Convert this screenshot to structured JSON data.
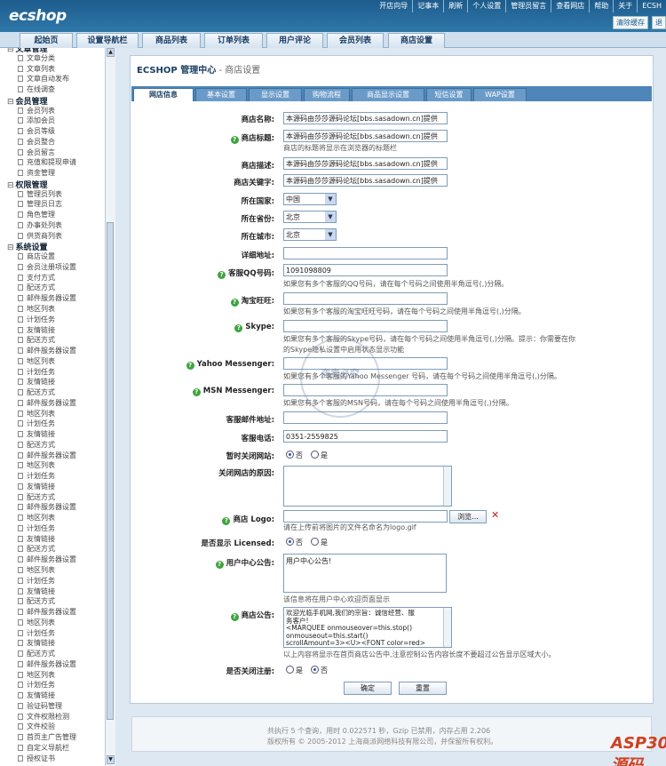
{
  "header": {
    "logo": "ecshop",
    "top_links": [
      "开店向导",
      "记事本",
      "刷新",
      "个人设置",
      "管理员留言",
      "查看网店",
      "帮助",
      "关于",
      "ECSH"
    ],
    "buttons": [
      "清除缓存",
      "退"
    ]
  },
  "main_nav": [
    "起始页",
    "设置导航栏",
    "商品列表",
    "订单列表",
    "用户评论",
    "会员列表",
    "商店设置"
  ],
  "sidebar": [
    {
      "t": "g",
      "label": "文章管理"
    },
    {
      "t": "i",
      "label": "文章分类"
    },
    {
      "t": "i",
      "label": "文章列表"
    },
    {
      "t": "i",
      "label": "文章自动发布"
    },
    {
      "t": "i",
      "label": "在线调查"
    },
    {
      "t": "g",
      "label": "会员管理"
    },
    {
      "t": "i",
      "label": "会员列表"
    },
    {
      "t": "i",
      "label": "添加会员"
    },
    {
      "t": "i",
      "label": "会员等级"
    },
    {
      "t": "i",
      "label": "会员整合"
    },
    {
      "t": "i",
      "label": "会员留言"
    },
    {
      "t": "i",
      "label": "充值和提现申请"
    },
    {
      "t": "i",
      "label": "资金管理"
    },
    {
      "t": "g",
      "label": "权限管理"
    },
    {
      "t": "i",
      "label": "管理员列表"
    },
    {
      "t": "i",
      "label": "管理员日志"
    },
    {
      "t": "i",
      "label": "角色管理"
    },
    {
      "t": "i",
      "label": "办事处列表"
    },
    {
      "t": "i",
      "label": "供货商列表"
    },
    {
      "t": "g",
      "label": "系统设置"
    },
    {
      "t": "i",
      "label": "商店设置"
    },
    {
      "t": "i",
      "label": "会员注册项设置"
    },
    {
      "t": "i",
      "label": "支付方式"
    },
    {
      "t": "i",
      "label": "配送方式"
    },
    {
      "t": "i",
      "label": "邮件服务器设置"
    },
    {
      "t": "i",
      "label": "地区列表"
    },
    {
      "t": "i",
      "label": "计划任务"
    },
    {
      "t": "i",
      "label": "友情链接"
    },
    {
      "t": "i",
      "label": "配送方式"
    },
    {
      "t": "i",
      "label": "邮件服务器设置"
    },
    {
      "t": "i",
      "label": "地区列表"
    },
    {
      "t": "i",
      "label": "计划任务"
    },
    {
      "t": "i",
      "label": "友情链接"
    },
    {
      "t": "i",
      "label": "配送方式"
    },
    {
      "t": "i",
      "label": "邮件服务器设置"
    },
    {
      "t": "i",
      "label": "地区列表"
    },
    {
      "t": "i",
      "label": "计划任务"
    },
    {
      "t": "i",
      "label": "友情链接"
    },
    {
      "t": "i",
      "label": "配送方式"
    },
    {
      "t": "i",
      "label": "邮件服务器设置"
    },
    {
      "t": "i",
      "label": "地区列表"
    },
    {
      "t": "i",
      "label": "计划任务"
    },
    {
      "t": "i",
      "label": "友情链接"
    },
    {
      "t": "i",
      "label": "配送方式"
    },
    {
      "t": "i",
      "label": "邮件服务器设置"
    },
    {
      "t": "i",
      "label": "地区列表"
    },
    {
      "t": "i",
      "label": "计划任务"
    },
    {
      "t": "i",
      "label": "友情链接"
    },
    {
      "t": "i",
      "label": "配送方式"
    },
    {
      "t": "i",
      "label": "邮件服务器设置"
    },
    {
      "t": "i",
      "label": "地区列表"
    },
    {
      "t": "i",
      "label": "计划任务"
    },
    {
      "t": "i",
      "label": "友情链接"
    },
    {
      "t": "i",
      "label": "配送方式"
    },
    {
      "t": "i",
      "label": "邮件服务器设置"
    },
    {
      "t": "i",
      "label": "地区列表"
    },
    {
      "t": "i",
      "label": "计划任务"
    },
    {
      "t": "i",
      "label": "友情链接"
    },
    {
      "t": "i",
      "label": "配送方式"
    },
    {
      "t": "i",
      "label": "邮件服务器设置"
    },
    {
      "t": "i",
      "label": "地区列表"
    },
    {
      "t": "i",
      "label": "计划任务"
    },
    {
      "t": "i",
      "label": "友情链接"
    },
    {
      "t": "i",
      "label": "验证码管理"
    },
    {
      "t": "i",
      "label": "文件权限检测"
    },
    {
      "t": "i",
      "label": "文件校验"
    },
    {
      "t": "i",
      "label": "首页主广告管理"
    },
    {
      "t": "i",
      "label": "自定义导航栏"
    },
    {
      "t": "i",
      "label": "授权证书"
    }
  ],
  "page": {
    "title": "ECSHOP 管理中心",
    "subtitle": " - 商店设置"
  },
  "tabs": [
    "网店信息",
    "基本设置",
    "显示设置",
    "购物流程",
    "商品显示设置",
    "短信设置",
    "WAP设置"
  ],
  "form": {
    "shop_name": {
      "label": "商店名称:",
      "value": "本源码由莎莎源码论坛[bbs.sasadown.cn]提供"
    },
    "shop_title": {
      "label": "商店标题:",
      "value": "本源码由莎莎源码论坛[bbs.sasadown.cn]提供",
      "note": "商店的标题将显示在浏览器的标题栏"
    },
    "shop_desc": {
      "label": "商店描述:",
      "value": "本源码由莎莎源码论坛[bbs.sasadown.cn]提供"
    },
    "shop_keywords": {
      "label": "商店关键字:",
      "value": "本源码由莎莎源码论坛[bbs.sasadown.cn]提供"
    },
    "country": {
      "label": "所在国家:",
      "value": "中国"
    },
    "province": {
      "label": "所在省份:",
      "value": "北京"
    },
    "city": {
      "label": "所在城市:",
      "value": "北京"
    },
    "address": {
      "label": "详细地址:",
      "value": ""
    },
    "qq": {
      "label": "客服QQ号码:",
      "value": "1091098809",
      "note": "如果您有多个客服的QQ号码，请在每个号码之间使用半角逗号(,)分隔。"
    },
    "ww": {
      "label": "淘宝旺旺:",
      "value": "",
      "note": "如果您有多个客服的淘宝旺旺号码，请在每个号码之间使用半角逗号(,)分隔。"
    },
    "skype": {
      "label": "Skype:",
      "value": "",
      "note1": "如果您有多个客服的Skype号码，请在每个号码之间使用半角逗号(,)分隔。提示：你需要在你",
      "note2": "的Skype隐私设置中启用状态显示功能"
    },
    "yahoo": {
      "label": "Yahoo Messenger:",
      "value": "",
      "note": "如果您有多个客服的Yahoo Messenger 号码，请在每个号码之间使用半角逗号(,)分隔。"
    },
    "msn": {
      "label": "MSN Messenger:",
      "value": "",
      "note": "如果您有多个客服的MSN号码，请在每个号码之间使用半角逗号(,)分隔。"
    },
    "email": {
      "label": "客服邮件地址:",
      "value": ""
    },
    "phone": {
      "label": "客服电话:",
      "value": "0351-2559825"
    },
    "closed": {
      "label": "暂时关闭网站:",
      "opt_no": "否",
      "opt_yes": "是"
    },
    "close_reason": {
      "label": "关闭网店的原因:"
    },
    "logo": {
      "label": "商店 Logo:",
      "browse": "浏览...",
      "note": "请在上传前将图片的文件名命名为logo.gif"
    },
    "licensed": {
      "label": "是否显示 Licensed:",
      "opt_no": "否",
      "opt_yes": "是"
    },
    "user_notice": {
      "label": "用户中心公告:",
      "value": "用户中心公告!",
      "note": "该信息将在用户中心欢迎页面显示"
    },
    "shop_notice": {
      "label": "商店公告:",
      "lines": [
        "欢迎光临手机网,我们的宗旨：诚信经营、服",
        "务客户!",
        "<MARQUEE onmouseover=this.stop()",
        "onmouseout=this.start()",
        "scrollAmount=3><U><FONT color=red>"
      ],
      "note": "以上内容将显示在首页商店公告中,注意控制公告内容长度不要超过公告显示区域大小。"
    },
    "reg_closed": {
      "label": "是否关闭注册:",
      "opt_yes": "是",
      "opt_no": "否"
    },
    "submit": "确定",
    "reset": "重置"
  },
  "footer": {
    "line1": "共执行 5 个查询，用时 0.022571 秒，Gzip 已禁用，内存占用 2.206",
    "line2": "版权所有 © 2005-2012 上海商派网络科技有限公司，并保留所有权利。"
  },
  "watermark": "ASP300源码",
  "stamp": "盗卖必究"
}
